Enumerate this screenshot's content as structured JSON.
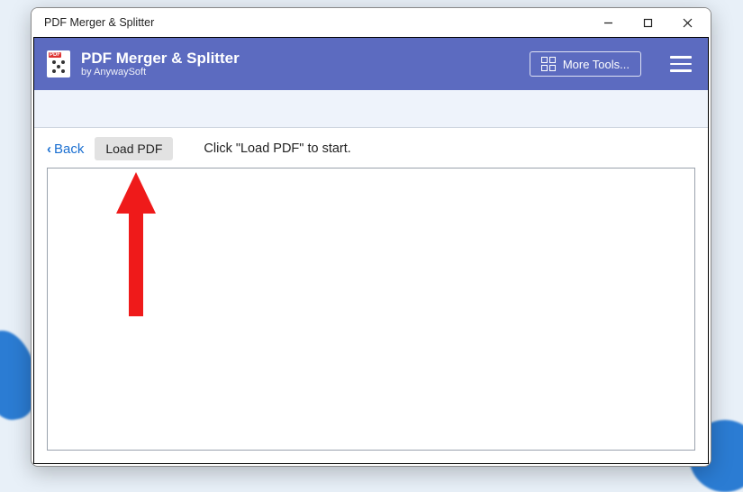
{
  "window": {
    "title": "PDF Merger & Splitter"
  },
  "header": {
    "appTitle": "PDF Merger & Splitter",
    "subtitle": "by AnywaySoft",
    "moreTools": "More Tools..."
  },
  "actions": {
    "backLabel": "Back",
    "loadLabel": "Load PDF",
    "hint": "Click \"Load PDF\" to start."
  }
}
